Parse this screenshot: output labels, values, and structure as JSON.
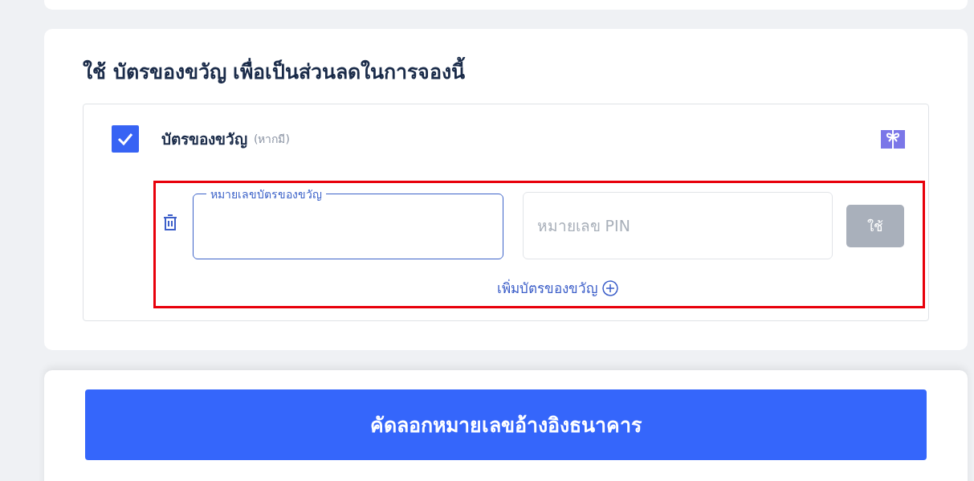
{
  "section": {
    "title": "ใช้ บัตรของขวัญ เพื่อเป็นส่วนลดในการจองนี้"
  },
  "gift_card": {
    "label": "บัตรของขวัญ",
    "note": "(หากมี)",
    "checked": true
  },
  "card_number": {
    "label": "หมายเลขบัตรของขวัญ",
    "focused": true
  },
  "pin": {
    "placeholder": "หมายเลข PIN"
  },
  "apply_button": {
    "label": "ใช้",
    "disabled": true
  },
  "add_link": {
    "label": "เพิ่มบัตรของขวัญ"
  },
  "highlighted": true,
  "submit_button": {
    "label": "คัดลอกหมายเลขอ้างอิงธนาคาร"
  }
}
